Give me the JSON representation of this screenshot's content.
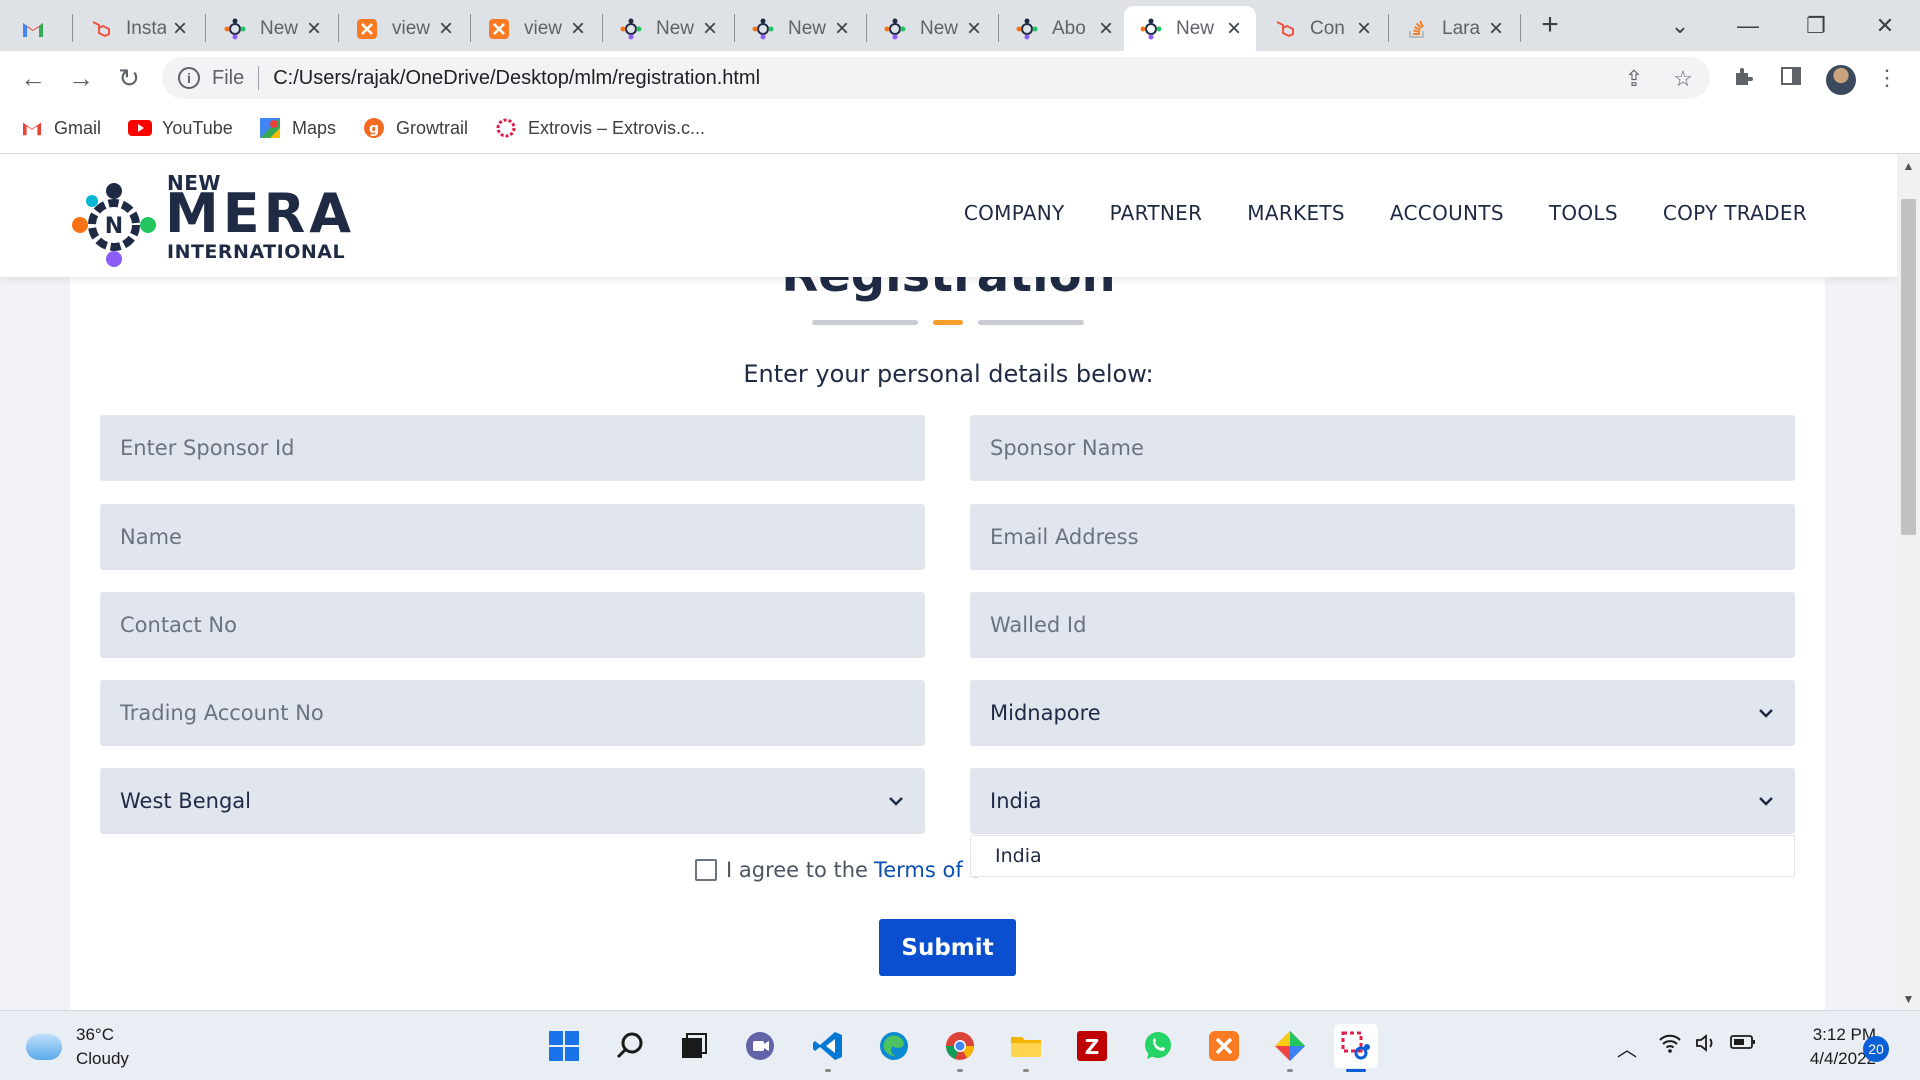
{
  "browser": {
    "tabs": [
      {
        "title": "Insta",
        "favicon": "laravel-icon",
        "active": false
      },
      {
        "title": "New",
        "favicon": "nmi-icon",
        "active": false
      },
      {
        "title": "view",
        "favicon": "xampp-icon",
        "active": false
      },
      {
        "title": "view",
        "favicon": "xampp-icon",
        "active": false
      },
      {
        "title": "New",
        "favicon": "nmi-icon",
        "active": false
      },
      {
        "title": "New",
        "favicon": "nmi-icon",
        "active": false
      },
      {
        "title": "New",
        "favicon": "nmi-icon",
        "active": false
      },
      {
        "title": "Abo",
        "favicon": "nmi-icon",
        "active": false
      },
      {
        "title": "New",
        "favicon": "nmi-icon",
        "active": true
      },
      {
        "title": "Con",
        "favicon": "laravel-icon",
        "active": false
      },
      {
        "title": "Lara",
        "favicon": "stackoverflow-icon",
        "active": false
      }
    ],
    "scheme_label": "File",
    "url": "C:/Users/rajak/OneDrive/Desktop/mlm/registration.html",
    "bookmarks": [
      {
        "label": "Gmail",
        "icon": "gmail-icon"
      },
      {
        "label": "YouTube",
        "icon": "youtube-icon"
      },
      {
        "label": "Maps",
        "icon": "maps-icon"
      },
      {
        "label": "Growtrail",
        "icon": "growtrail-icon"
      },
      {
        "label": "Extrovis – Extrovis.c...",
        "icon": "extrovis-icon"
      }
    ]
  },
  "site": {
    "logo": {
      "line1": "NEW",
      "line2": "MERA",
      "line3": "INTERNATIONAL"
    },
    "nav": [
      "COMPANY",
      "PARTNER",
      "MARKETS",
      "ACCOUNTS",
      "TOOLS",
      "COPY TRADER"
    ]
  },
  "form": {
    "title": "Registration",
    "subtitle": "Enter your personal details below:",
    "placeholders": {
      "sponsor_id": "Enter Sponsor Id",
      "sponsor_name": "Sponsor Name",
      "name": "Name",
      "email": "Email Address",
      "contact": "Contact No",
      "wallet": "Walled Id",
      "trading_account": "Trading Account No"
    },
    "selects": {
      "district": "Midnapore",
      "state": "West Bengal",
      "country": "India"
    },
    "country_options": [
      "India"
    ],
    "agree_text": "I agree to the",
    "terms_link": "Terms of S",
    "submit_label": "Submit"
  },
  "taskbar": {
    "weather": {
      "temp": "36°C",
      "condition": "Cloudy"
    },
    "time": "3:12 PM",
    "date": "4/4/2022",
    "notifications": "20"
  },
  "colors": {
    "accent_orange": "#f59e2b",
    "divider_gray": "#c9ccd2",
    "submit_blue": "#0a4fd0",
    "field_bg": "#e1e5ee",
    "brand_navy": "#1f2a44"
  }
}
